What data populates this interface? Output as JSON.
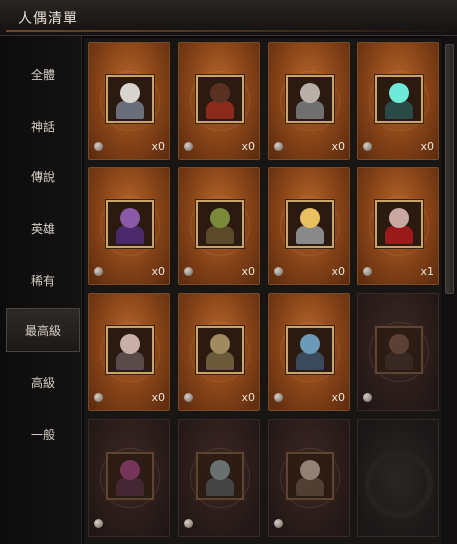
{
  "window": {
    "title": "人偶清單"
  },
  "sidebar": {
    "items": [
      {
        "label": "全體"
      },
      {
        "label": "神話"
      },
      {
        "label": "傳說"
      },
      {
        "label": "英雄"
      },
      {
        "label": "稀有"
      },
      {
        "label": "最高級"
      },
      {
        "label": "高級"
      },
      {
        "label": "一般"
      }
    ],
    "active_index": 5
  },
  "cards": [
    {
      "count": "x0",
      "state": "lit",
      "icon": "white-haired-knight-portrait",
      "face": "#d8d4d0",
      "body": "#6a6e7a"
    },
    {
      "count": "x0",
      "state": "lit",
      "icon": "dark-mage-portrait",
      "face": "#5a3020",
      "body": "#8a2a1a"
    },
    {
      "count": "x0",
      "state": "lit",
      "icon": "armored-minotaur-portrait",
      "face": "#b8b0a8",
      "body": "#707070"
    },
    {
      "count": "x0",
      "state": "lit",
      "icon": "crystal-orb-portrait",
      "face": "#6ee8d8",
      "body": "#2a4a48"
    },
    {
      "count": "x0",
      "state": "lit",
      "icon": "witch-hat-portrait",
      "face": "#8a5aa8",
      "body": "#4a2a6a"
    },
    {
      "count": "x0",
      "state": "lit",
      "icon": "goblin-warrior-portrait",
      "face": "#7a8a3a",
      "body": "#5a4a2a"
    },
    {
      "count": "x0",
      "state": "lit",
      "icon": "golden-knight-portrait",
      "face": "#e8c060",
      "body": "#8a8a8a"
    },
    {
      "count": "x1",
      "state": "lit",
      "icon": "red-sorcerer-portrait",
      "face": "#c8a8a0",
      "body": "#9a1a1a"
    },
    {
      "count": "x0",
      "state": "lit",
      "icon": "elf-warrior-portrait",
      "face": "#c8b0a8",
      "body": "#5a4a4a"
    },
    {
      "count": "x0",
      "state": "lit",
      "icon": "bronze-golem-portrait",
      "face": "#a08a60",
      "body": "#6a5a3a"
    },
    {
      "count": "x0",
      "state": "lit",
      "icon": "blue-armor-portrait",
      "face": "#6a9ab8",
      "body": "#3a4a5a"
    },
    {
      "count": "",
      "state": "dim",
      "icon": "dark-warrior-portrait",
      "face": "#6a4a3a",
      "body": "#3a2a24"
    },
    {
      "count": "",
      "state": "dim",
      "icon": "demon-portrait",
      "face": "#8a3a6a",
      "body": "#4a2a3a"
    },
    {
      "count": "",
      "state": "dim",
      "icon": "stone-guardian-portrait",
      "face": "#7a8a8a",
      "body": "#4a5050"
    },
    {
      "count": "",
      "state": "dim",
      "icon": "beast-portrait",
      "face": "#b0a090",
      "body": "#5a4a3a"
    },
    {
      "count": "",
      "state": "empty",
      "icon": "",
      "face": "",
      "body": ""
    }
  ]
}
